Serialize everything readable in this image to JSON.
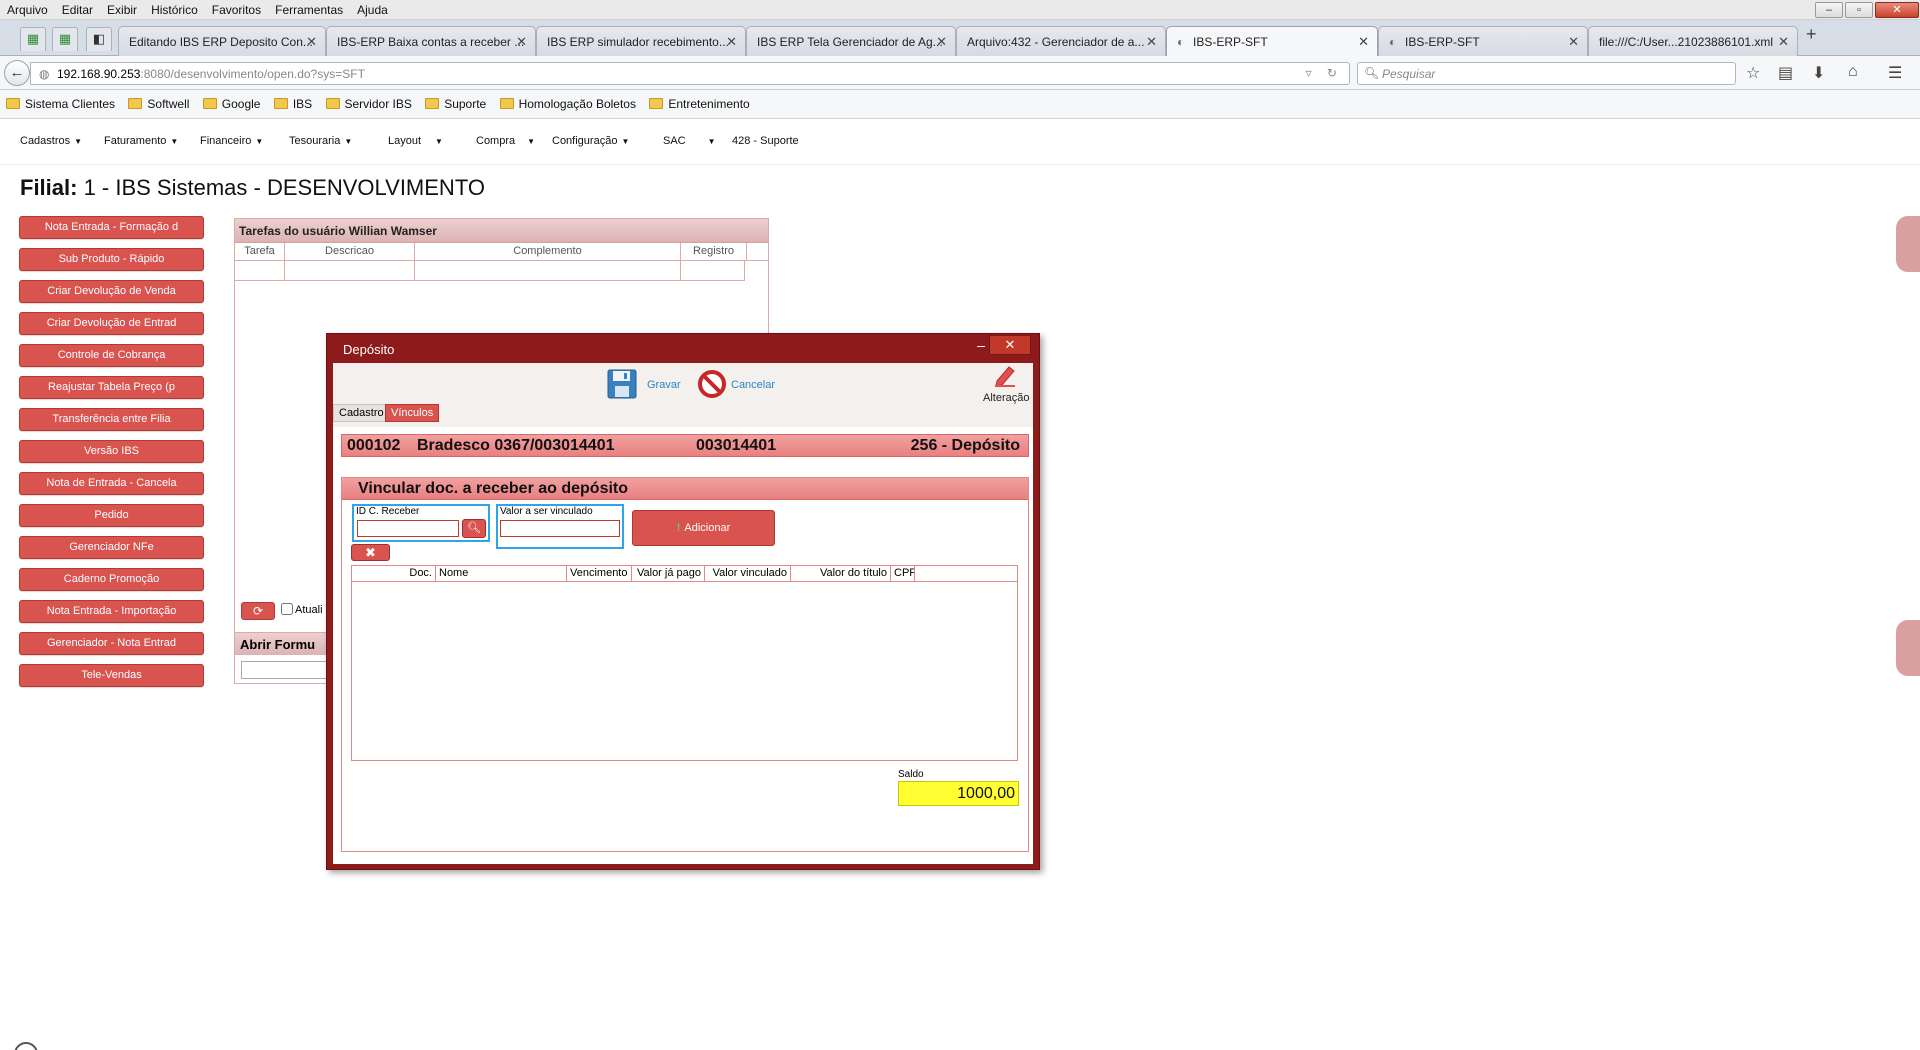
{
  "browser": {
    "menu": [
      "Arquivo",
      "Editar",
      "Exibir",
      "Histórico",
      "Favoritos",
      "Ferramentas",
      "Ajuda"
    ],
    "tabs": [
      {
        "label": "Editando IBS ERP Deposito Con..."
      },
      {
        "label": "IBS-ERP Baixa contas a receber ..."
      },
      {
        "label": "IBS ERP simulador recebimento..."
      },
      {
        "label": "IBS ERP Tela Gerenciador de Ag..."
      },
      {
        "label": "Arquivo:432 - Gerenciador de a..."
      },
      {
        "label": "IBS-ERP-SFT"
      },
      {
        "label": "IBS-ERP-SFT"
      },
      {
        "label": "file:///C:/User...21023886101.xml"
      }
    ],
    "url_host": "192.168.90.253",
    "url_path": ":8080/desenvolvimento/open.do?sys=SFT",
    "search_placeholder": "Pesquisar",
    "bookmarks": [
      "Sistema Clientes",
      "Softwell",
      "Google",
      "IBS",
      "Servidor IBS",
      "Suporte",
      "Homologação Boletos",
      "Entretenimento"
    ]
  },
  "app": {
    "nav": [
      {
        "label": "Cadastros"
      },
      {
        "label": "Faturamento"
      },
      {
        "label": "Financeiro"
      },
      {
        "label": "Tesouraria"
      },
      {
        "label": "Layout"
      },
      {
        "label": "Compra"
      },
      {
        "label": "Configuração"
      },
      {
        "label": "SAC"
      },
      {
        "label": "428 - Suporte"
      }
    ],
    "filial_label": "Filial:",
    "filial_value": "1 - IBS Sistemas - DESENVOLVIMENTO",
    "shortcuts": [
      "Nota Entrada - Formação d",
      "Sub Produto - Rápido",
      "Criar Devolução de Venda",
      "Criar Devolução de Entrad",
      "Controle de Cobrança",
      "Reajustar Tabela Preço (p",
      "Transferência entre Filia",
      "Versão IBS",
      "Nota de Entrada - Cancela",
      "Pedido",
      "Gerenciador NFe",
      "Caderno Promoção",
      "Nota Entrada - Importação",
      "Gerenciador - Nota Entrad",
      "Tele-Vendas"
    ],
    "tasks": {
      "title": "Tarefas do usuário Willian Wamser",
      "columns": [
        "Tarefa",
        "Descricao",
        "Complemento",
        "Registro"
      ],
      "refresh_checkbox_label": "Atuali"
    },
    "abrir_title": "Abrir Formu"
  },
  "modal": {
    "title": "Depósito",
    "toolbar": {
      "save": "Gravar",
      "cancel": "Cancelar",
      "edit": "Alteração"
    },
    "tabs": {
      "cadastro": "Cadastro",
      "vinculos": "Vínculos"
    },
    "info": {
      "code": "000102",
      "bank": "Bradesco 0367/003014401",
      "account": "003014401",
      "type": "256 - Depósito"
    },
    "section_title": "Vincular doc. a receber ao depósito",
    "id_receber_label": "ID C. Receber",
    "id_receber_value": "",
    "valor_label": "Valor a ser vinculado",
    "valor_value": "",
    "add_label": "Adicionar",
    "grid_columns": [
      "Doc.",
      "Nome",
      "Vencimento",
      "Valor já pago",
      "Valor vinculado",
      "Valor do título",
      "CPF"
    ],
    "saldo_label": "Saldo",
    "saldo_value": "1000,00"
  },
  "colors": {
    "accent_red": "#d9534f",
    "modal_frame": "#8e1b1b",
    "highlight_blue": "#2fa4e7",
    "saldo_yellow": "#ffff33"
  }
}
